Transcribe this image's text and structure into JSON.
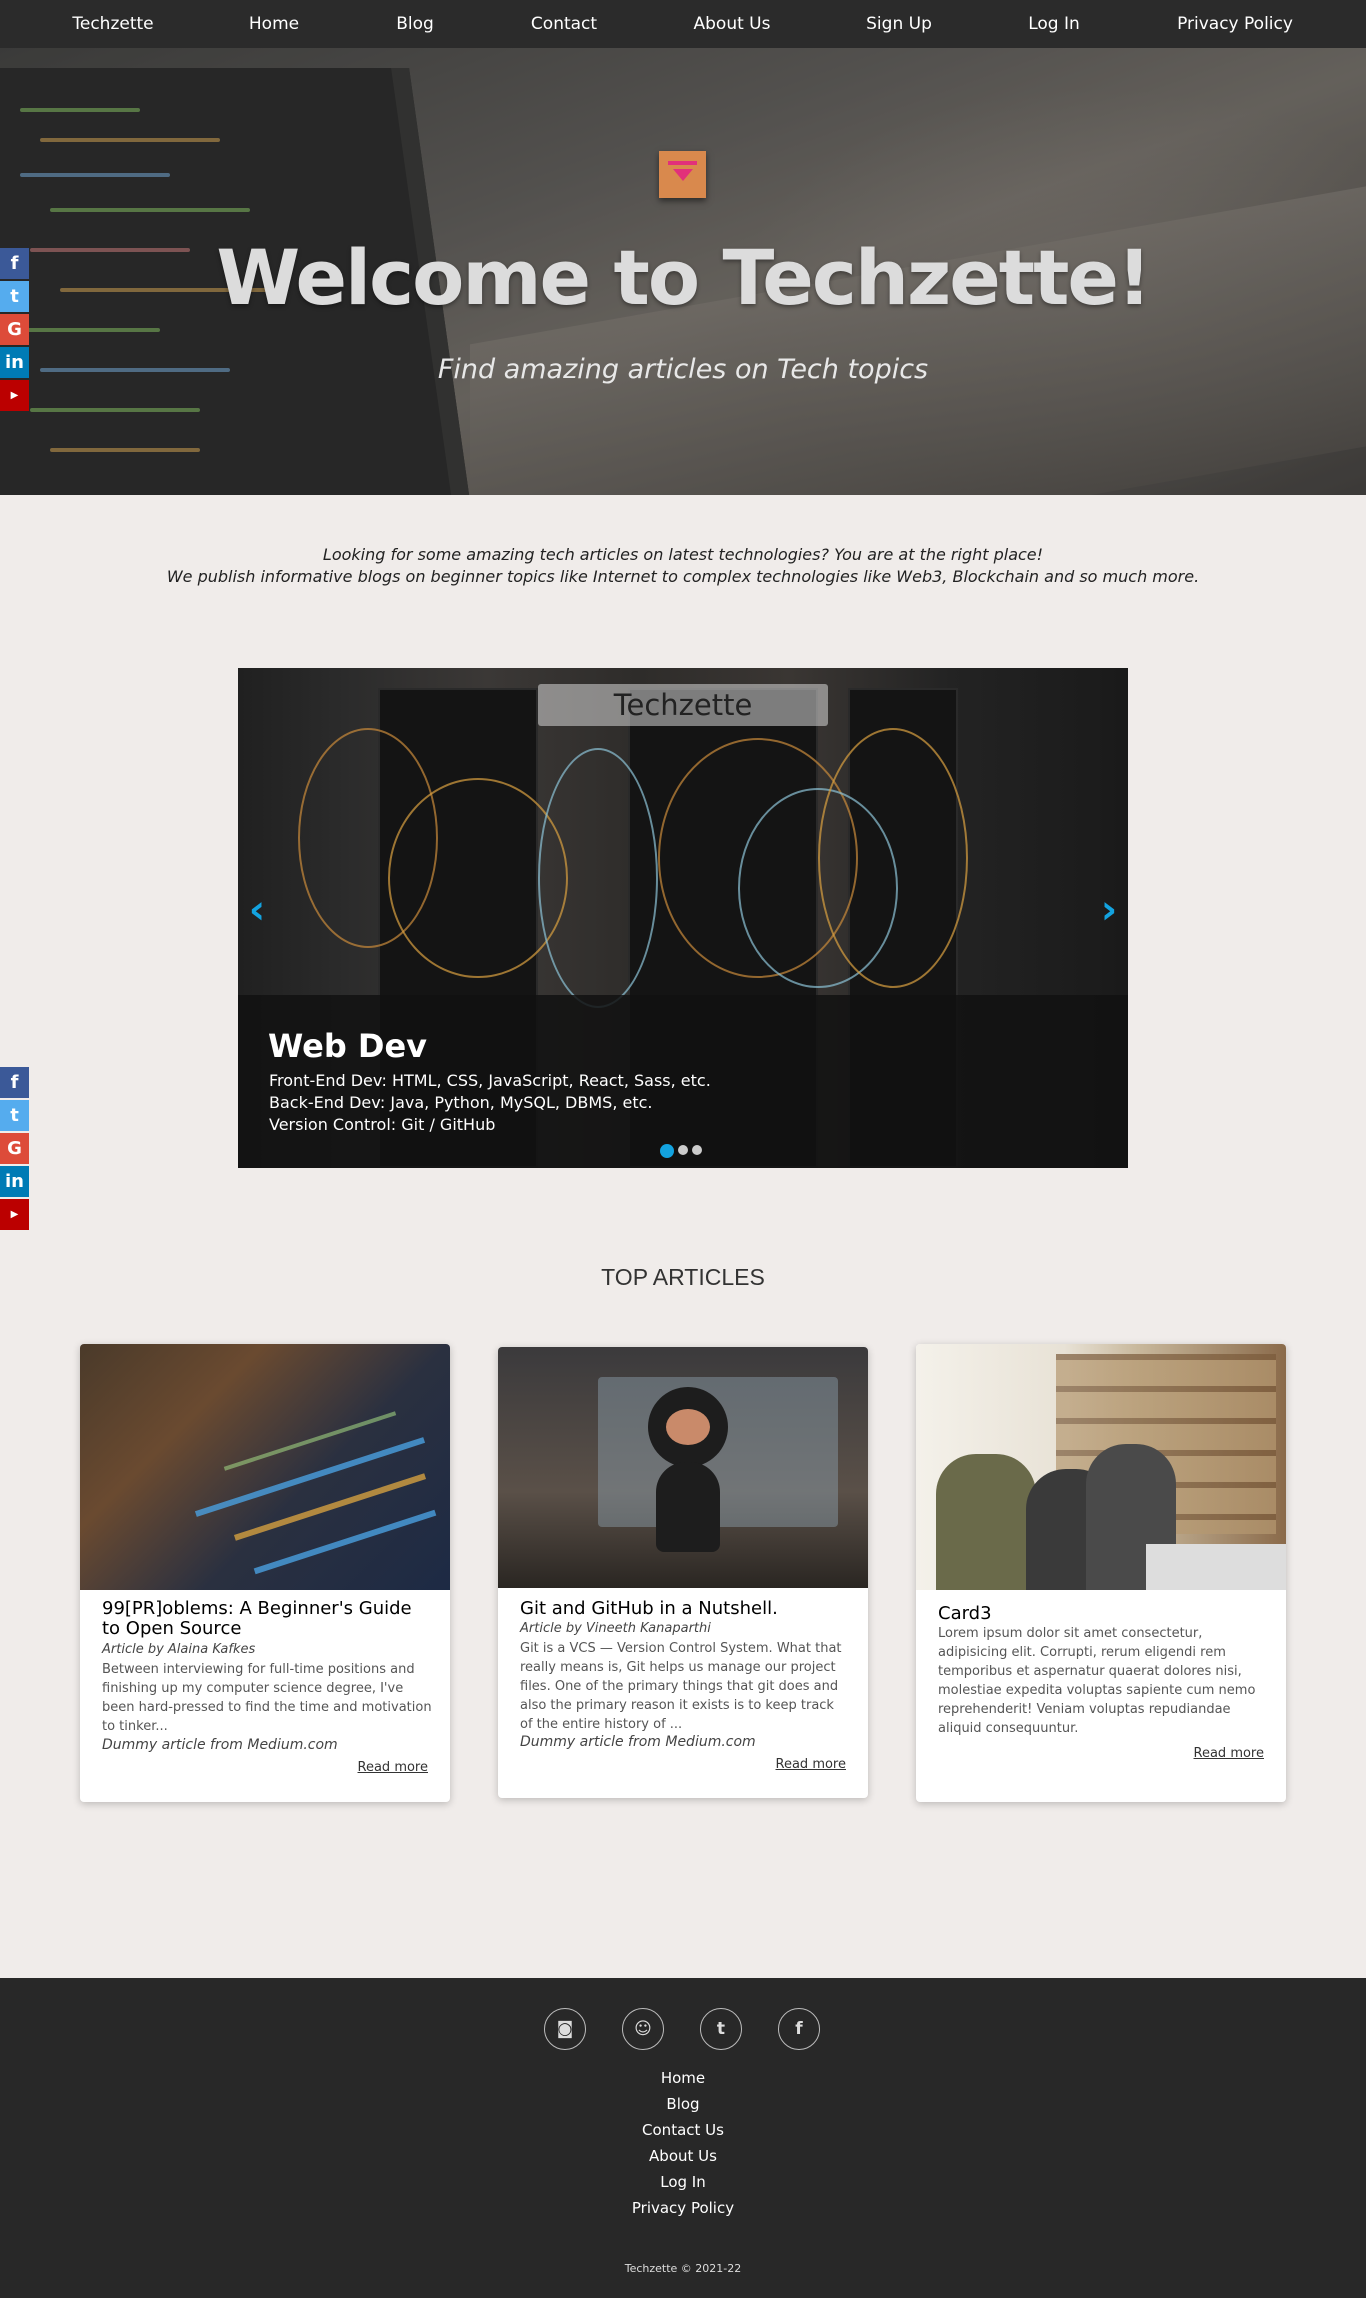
{
  "nav": {
    "brand": "Techzette",
    "items": [
      "Home",
      "Blog",
      "Contact",
      "About Us",
      "Sign Up",
      "Log In",
      "Privacy Policy"
    ]
  },
  "hero": {
    "title": "Welcome to Techzette!",
    "subtitle": "Find amazing articles on Tech topics"
  },
  "social": [
    "facebook-icon",
    "twitter-icon",
    "google-icon",
    "linkedin-icon",
    "youtube-icon"
  ],
  "intro": {
    "line1": "Looking for some amazing tech articles on latest technologies? You are at the right place!",
    "line2": "We publish informative blogs on beginner topics like Internet to complex technologies like Web3, Blockchain and so much more."
  },
  "carousel": {
    "title": "Techzette",
    "heading": "Web Dev",
    "lines": [
      "Front-End Dev: HTML, CSS, JavaScript, React, Sass, etc.",
      "Back-End Dev: Java, Python, MySQL, DBMS, etc.",
      "Version Control: Git / GitHub"
    ],
    "slide_count": 3,
    "active_slide": 1,
    "accent": "#13a3e0"
  },
  "top_articles": {
    "title": "TOP ARTICLES",
    "cards": [
      {
        "title": "99[PR]oblems: A Beginner's Guide to Open Source",
        "author": "Article by Alaina Kafkes",
        "text": "Between interviewing for full-time positions and finishing up my computer science degree, I've been hard-pressed to find the time and motivation to tinker...",
        "source": "Dummy article from Medium.com",
        "more": "Read more"
      },
      {
        "title": "Git and GitHub in a Nutshell.",
        "author": "Article by Vineeth Kanaparthi",
        "text": "Git is a VCS — Version Control System. What that really means is, Git helps us manage our project files. One of the primary things that git does and also the primary reason it exists is to keep track of the entire history of ...",
        "source": "Dummy article from Medium.com",
        "more": "Read more"
      },
      {
        "title": "Card3",
        "text": "Lorem ipsum dolor sit amet consectetur, adipisicing elit. Corrupti, rerum eligendi rem temporibus et aspernatur quaerat dolores nisi, molestiae expedita voluptas sapiente cum nemo reprehenderit! Veniam voluptas repudiandae aliquid consequuntur.",
        "more": "Read more"
      }
    ]
  },
  "footer": {
    "icons": [
      "instagram-icon",
      "snapchat-icon",
      "twitter-icon",
      "facebook-icon"
    ],
    "links": [
      "Home",
      "Blog",
      "Contact Us",
      "About Us",
      "Log In",
      "Privacy Policy"
    ],
    "copyright": "Techzette © 2021-22"
  }
}
